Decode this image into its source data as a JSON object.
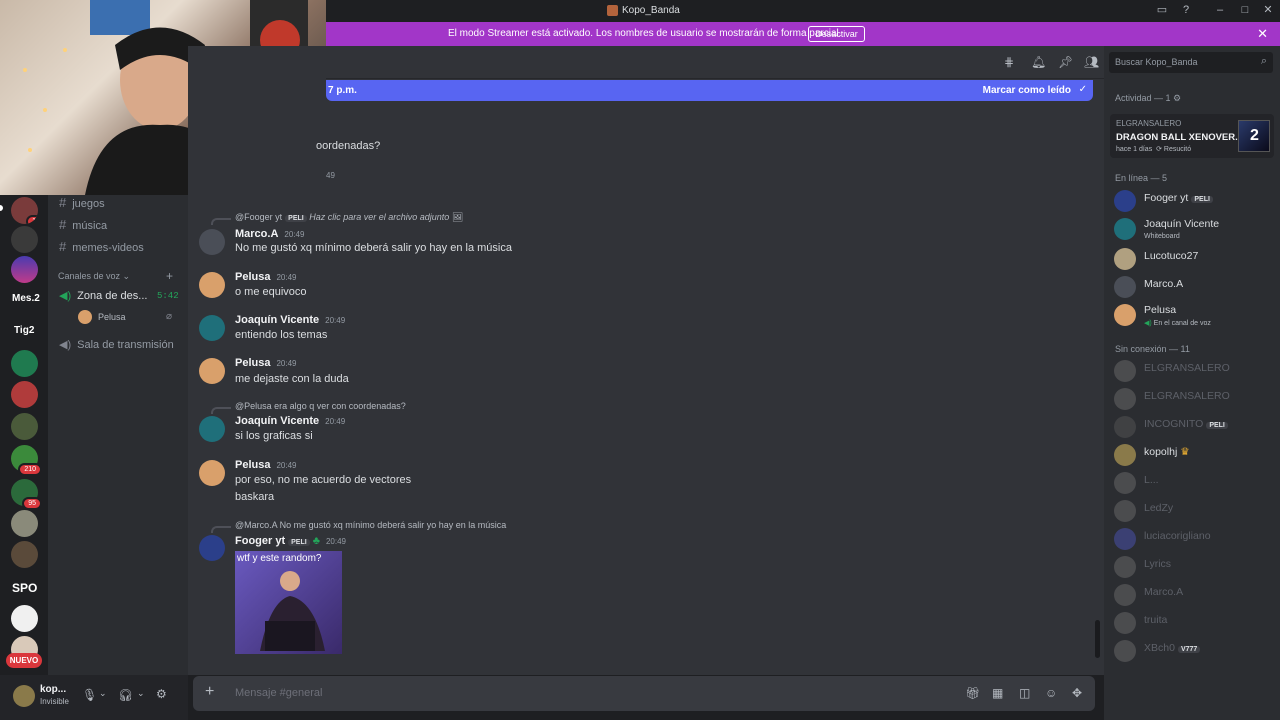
{
  "window": {
    "title": "Kopo_Banda"
  },
  "banner": {
    "text": "El modo Streamer está activado. Los nombres de usuario se mostrarán de forma parcial.",
    "button": "Desactivar"
  },
  "newbar": {
    "left": "7 p.m.",
    "right": "Marcar como leído"
  },
  "search": {
    "placeholder": "Buscar Kopo_Banda"
  },
  "guilds": [
    {
      "badge": "1"
    },
    {
      "badge": ""
    },
    {
      "badge": ""
    },
    {
      "text": "Mes.2"
    },
    {
      "text": "Tig2"
    },
    {
      "badge": ""
    },
    {
      "badge": ""
    },
    {
      "badge": ""
    },
    {
      "badge": "210"
    },
    {
      "badge": "95"
    },
    {
      "badge": ""
    },
    {
      "badge": ""
    },
    {
      "text": "SPO"
    },
    {
      "badge": ""
    },
    {
      "badge": ""
    }
  ],
  "nuevo": "NUEVO",
  "channels": {
    "text": [
      "juegos",
      "música",
      "memes-videos"
    ],
    "voice_category": "Canales de voz",
    "voice": [
      {
        "name": "Zona de des...",
        "time": "5:42",
        "members": [
          "Pelusa"
        ]
      },
      {
        "name": "Sala de transmisión"
      }
    ]
  },
  "user": {
    "name": "kop...",
    "status": "Invisible"
  },
  "messages": {
    "partial_top": "oordenadas?",
    "partial_ts": "49",
    "items": [
      {
        "reply_user": "@Fooger yt",
        "reply_tag": "PELI",
        "reply_text": "Haz clic para ver el archivo adjunto",
        "author": "Marco.A",
        "time": "20:49",
        "lines": [
          "No me gustó xq mínimo deberá salir yo hay en la música"
        ]
      },
      {
        "author": "Pelusa",
        "time": "20:49",
        "lines": [
          "o me equivoco"
        ]
      },
      {
        "author": "Joaquín Vicente",
        "time": "20:49",
        "lines": [
          "entiendo los temas"
        ]
      },
      {
        "author": "Pelusa",
        "time": "20:49",
        "lines": [
          "me dejaste con la duda"
        ]
      },
      {
        "reply_user": "@Pelusa",
        "reply_text": "era algo q ver con coordenadas?",
        "author": "Joaquín Vicente",
        "time": "20:49",
        "lines": [
          "si los graficas si"
        ]
      },
      {
        "author": "Pelusa",
        "time": "20:49",
        "lines": [
          "por eso, no me acuerdo de vectores",
          "baskara"
        ]
      },
      {
        "reply_user": "@Marco.A",
        "reply_text": "No me gustó xq mínimo deberá salir yo hay en la música",
        "author": "Fooger yt",
        "tag": "PELI",
        "time": "20:49",
        "image_caption": "wtf y este random?"
      }
    ]
  },
  "composer": {
    "placeholder": "Mensaje #general"
  },
  "members": {
    "activity_header": "Actividad — 1",
    "activity": {
      "user": "ELGRANSALERO",
      "game": "DRAGON BALL XENOVER...",
      "time": "hace 1 días",
      "extra": "Resucitó"
    },
    "online_header": "En línea — 5",
    "online": [
      {
        "name": "Fooger yt",
        "tag": "PELI",
        "sub": ""
      },
      {
        "name": "Joaquín Vicente",
        "sub": "Whiteboard"
      },
      {
        "name": "Lucotuco27",
        "sub": ""
      },
      {
        "name": "Marco.A",
        "sub": ""
      },
      {
        "name": "Pelusa",
        "sub": "En el canal de voz"
      }
    ],
    "offline_header": "Sin conexión — 11",
    "offline": [
      {
        "name": "ELGRANSALERO"
      },
      {
        "name": "ELGRANSALERO"
      },
      {
        "name": "INCOGNITO",
        "tag": "PELI"
      },
      {
        "name": "kopolhj"
      },
      {
        "name": "L..."
      },
      {
        "name": "LedZy"
      },
      {
        "name": "luciacorigliano"
      },
      {
        "name": "Lyrics"
      },
      {
        "name": "Marco.A"
      },
      {
        "name": "truita"
      },
      {
        "name": "XBch0",
        "tag": "V777"
      }
    ]
  }
}
